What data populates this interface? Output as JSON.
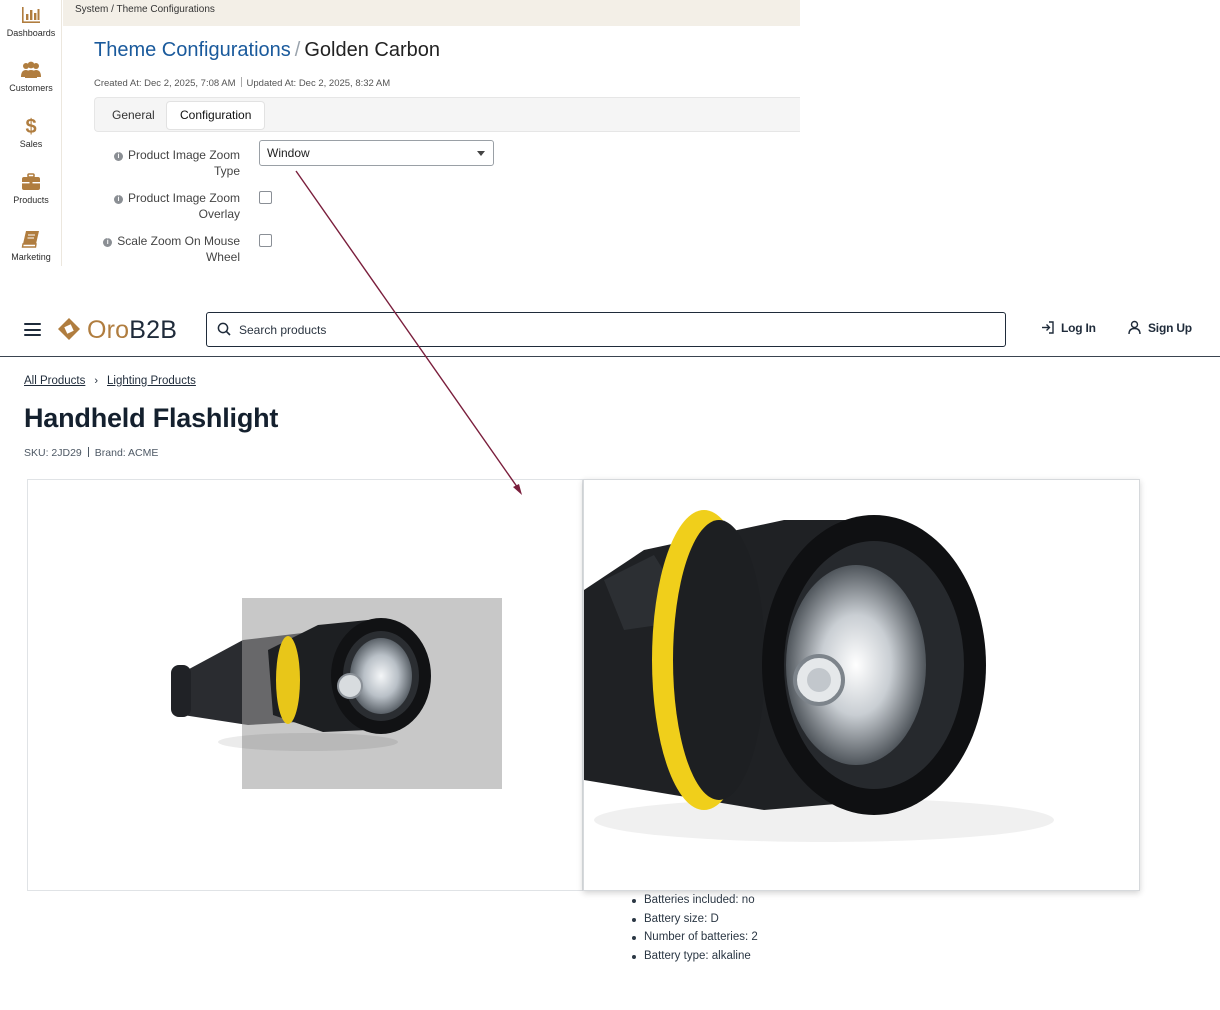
{
  "admin": {
    "breadcrumb": "System / Theme Configurations",
    "title_link": "Theme Configurations",
    "title_sep": "/",
    "title_name": "Golden Carbon",
    "created": "Created At: Dec 2, 2025, 7:08 AM",
    "updated": "Updated At: Dec 2, 2025, 8:32 AM",
    "tabs": [
      {
        "label": "General"
      },
      {
        "label": "Configuration"
      }
    ],
    "sidebar": [
      {
        "label": "Dashboards",
        "icon": "bar-chart-icon"
      },
      {
        "label": "Customers",
        "icon": "users-icon"
      },
      {
        "label": "Sales",
        "icon": "dollar-icon"
      },
      {
        "label": "Products",
        "icon": "briefcase-icon"
      },
      {
        "label": "Marketing",
        "icon": "book-icon"
      }
    ],
    "fields": {
      "zoom_type_label_1": "Product Image Zoom",
      "zoom_type_label_2": "Type",
      "zoom_type_value": "Window",
      "overlay_label_1": "Product Image Zoom",
      "overlay_label_2": "Overlay",
      "scale_label_1": "Scale Zoom On Mouse",
      "scale_label_2": "Wheel"
    },
    "accent": "#b07d3f"
  },
  "store": {
    "logo_oro": "Oro",
    "logo_b2b": "B2B",
    "search_placeholder": "Search products",
    "login": "Log In",
    "signup": "Sign Up",
    "crumbs": [
      "All Products",
      "Lighting Products"
    ],
    "product_title": "Handheld Flashlight",
    "sku": "SKU: 2JD29",
    "brand": "Brand: ACME",
    "attributes": [
      "Batteries included: no",
      "Battery size: D",
      "Number of batteries: 2",
      "Battery type: alkaline"
    ]
  }
}
